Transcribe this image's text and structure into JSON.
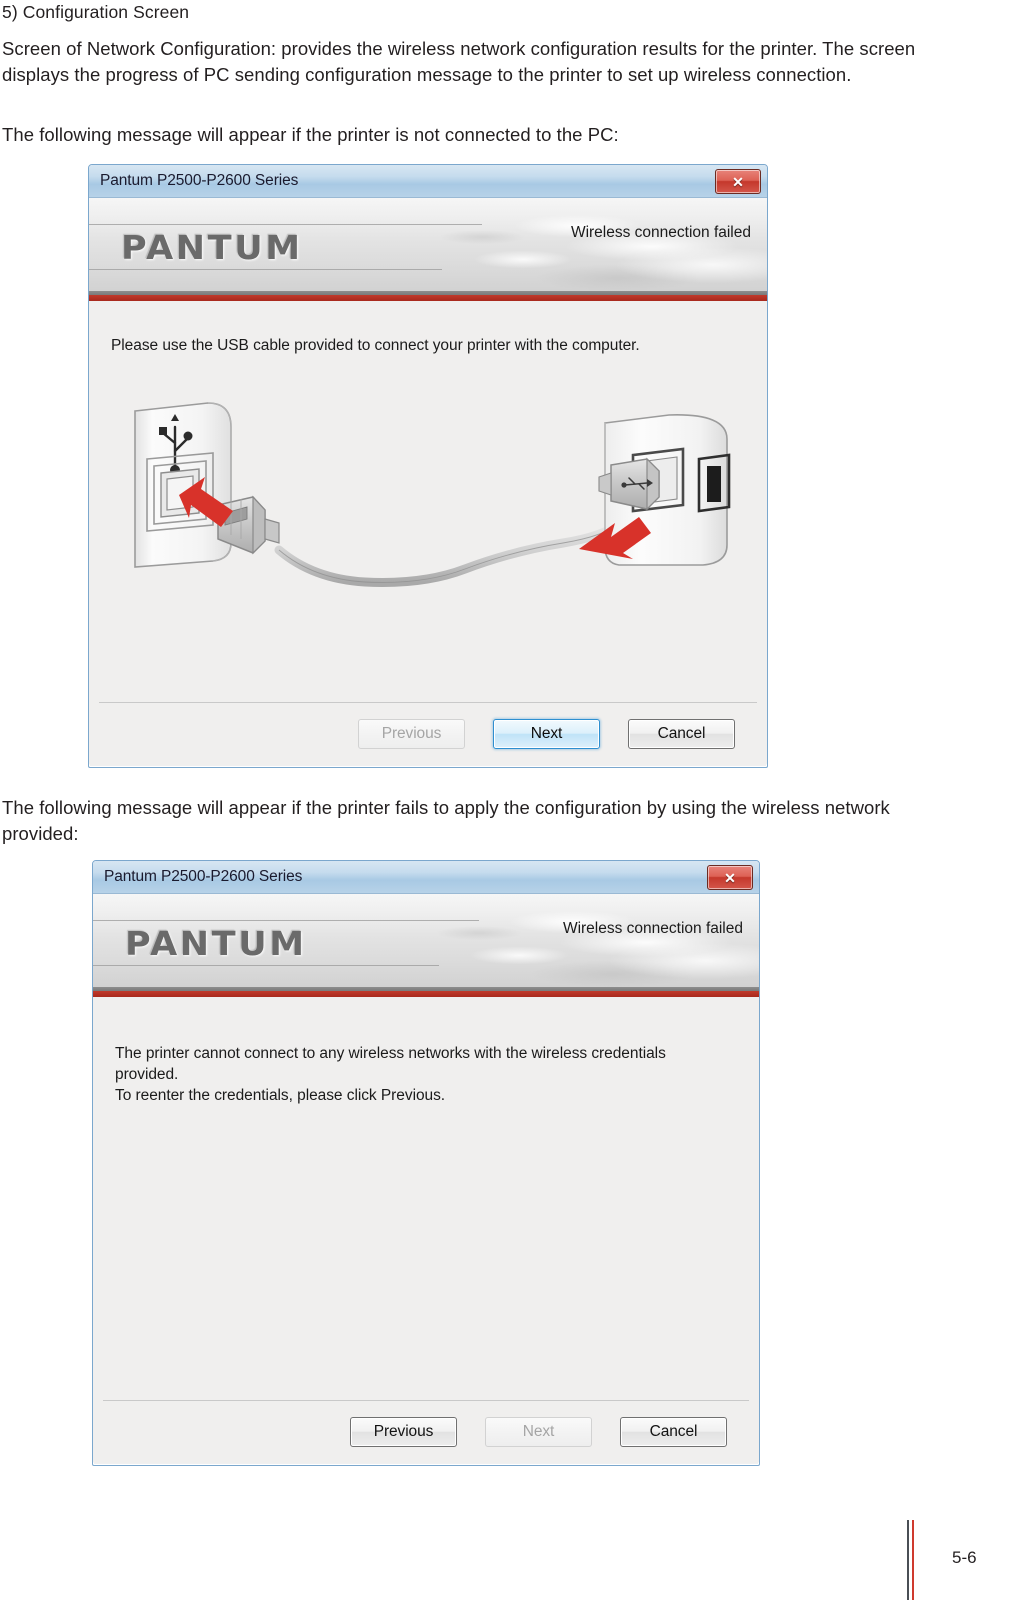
{
  "document": {
    "heading": "5) Configuration Screen",
    "paragraph_1": "Screen of Network Configuration: provides the wireless network configuration results for the printer. The screen displays the progress of PC sending configuration message to the printer to set up wireless connection.",
    "paragraph_2": "The following message will appear if the printer is not connected to the PC:",
    "paragraph_3": "The following message will appear if the printer fails to apply the configuration by using the wireless network provided:",
    "page_number": "5-6"
  },
  "dialog_1": {
    "title": "Pantum P2500-P2600 Series",
    "close_glyph": "✕",
    "close_icon_name": "close-icon",
    "logo_text": "PANTUM",
    "status_text": "Wireless connection failed",
    "message": "Please use the USB cable provided to connect your printer with the computer.",
    "illustration": "usb-cable-connection-diagram",
    "buttons": {
      "previous": {
        "label": "Previous",
        "state": "disabled"
      },
      "next": {
        "label": "Next",
        "state": "focused"
      },
      "cancel": {
        "label": "Cancel",
        "state": "normal"
      }
    }
  },
  "dialog_2": {
    "title": "Pantum P2500-P2600 Series",
    "close_glyph": "✕",
    "close_icon_name": "close-icon",
    "logo_text": "PANTUM",
    "status_text": "Wireless connection failed",
    "message": "The printer cannot connect to any wireless networks with the wireless credentials provided.\nTo reenter the credentials, please click Previous.",
    "buttons": {
      "previous": {
        "label": "Previous",
        "state": "normal"
      },
      "next": {
        "label": "Next",
        "state": "disabled"
      },
      "cancel": {
        "label": "Cancel",
        "state": "normal"
      }
    }
  },
  "colors": {
    "accent_red": "#c0392b",
    "titlebar_blue": "#a8c9e4",
    "close_red": "#c4382c",
    "focus_blue": "#2e8fd0",
    "arrow_red": "#d8322a"
  }
}
